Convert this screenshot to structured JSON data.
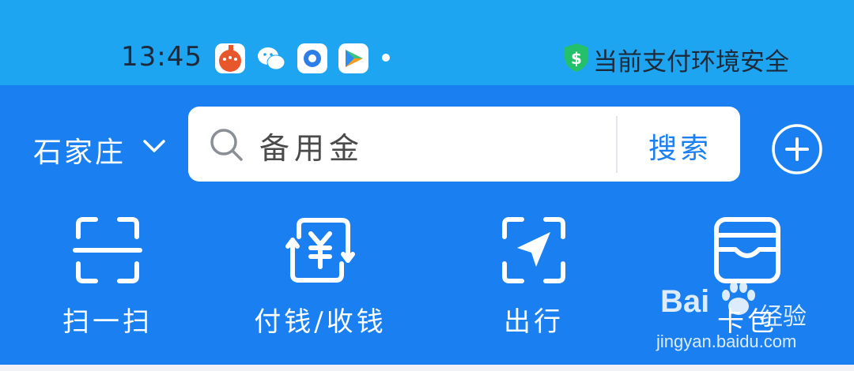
{
  "status_bar": {
    "time": "13:45",
    "notification_icons": [
      "tomato-app-icon",
      "wechat-icon",
      "circle-app-icon",
      "video-app-icon"
    ],
    "security_text": "当前支付环境安全",
    "security_icon": "shield-icon"
  },
  "header": {
    "city": "石家庄",
    "search": {
      "value": "备用金",
      "button_label": "搜索"
    },
    "add_icon": "plus-circle-icon"
  },
  "quick_actions": [
    {
      "label": "扫一扫",
      "icon": "scan-icon"
    },
    {
      "label": "付钱/收钱",
      "icon": "pay-receive-icon"
    },
    {
      "label": "出行",
      "icon": "travel-icon"
    },
    {
      "label": "卡包",
      "icon": "card-wallet-icon"
    }
  ],
  "watermark": {
    "brand": "Bai",
    "brand_suffix": "经验",
    "url": "jingyan.baidu.com"
  },
  "colors": {
    "status_bar_bg": "#1ea5f2",
    "main_bg": "#1a7ff0",
    "accent": "#1a7ff0"
  }
}
